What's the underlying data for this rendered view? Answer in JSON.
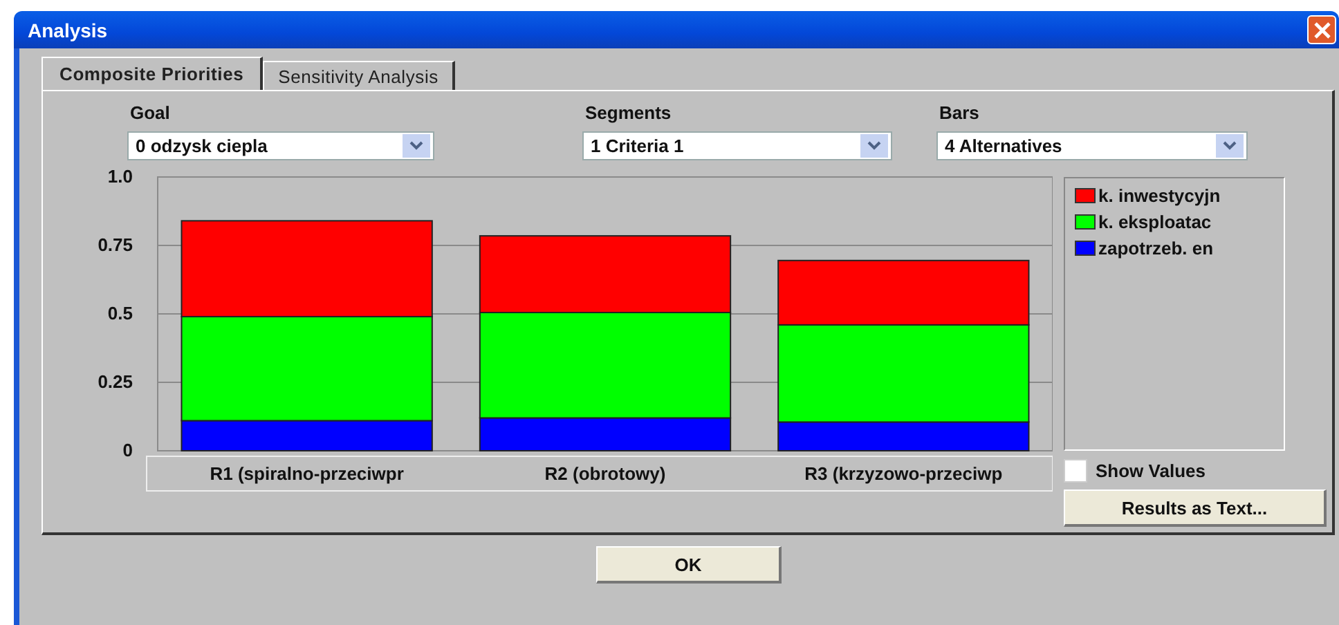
{
  "window": {
    "title": "Analysis"
  },
  "tabs": [
    {
      "label": "Composite Priorities",
      "selected": true
    },
    {
      "label": "Sensitivity Analysis",
      "selected": false
    }
  ],
  "selectors": [
    {
      "label": "Goal",
      "value": "0 odzysk ciepla"
    },
    {
      "label": "Segments",
      "value": "1 Criteria 1"
    },
    {
      "label": "Bars",
      "value": "4 Alternatives"
    }
  ],
  "chart_data": {
    "type": "bar",
    "stacked": true,
    "categories": [
      "R1 (spiralno-przeciwpr",
      "R2 (obrotowy)",
      "R3 (krzyzowo-przeciwp"
    ],
    "ylim": [
      0,
      1
    ],
    "grid": true,
    "yticks": [
      {
        "value": 0,
        "label": "0"
      },
      {
        "value": 0.25,
        "label": "0.25"
      },
      {
        "value": 0.5,
        "label": "0.5"
      },
      {
        "value": 0.75,
        "label": "0.75"
      },
      {
        "value": 1,
        "label": "1.0"
      }
    ],
    "series": [
      {
        "name": "zapotrzeb. en",
        "color": "#0000ff",
        "values": [
          0.11,
          0.12,
          0.105
        ]
      },
      {
        "name": "k. eksploatac",
        "color": "#00ff00",
        "values": [
          0.38,
          0.385,
          0.355
        ]
      },
      {
        "name": "k. inwestycyjn",
        "color": "#ff0000",
        "values": [
          0.35,
          0.28,
          0.235
        ]
      }
    ]
  },
  "show_values": {
    "label": "Show Values",
    "checked": false
  },
  "results_button": "Results as Text...",
  "ok_button": "OK"
}
